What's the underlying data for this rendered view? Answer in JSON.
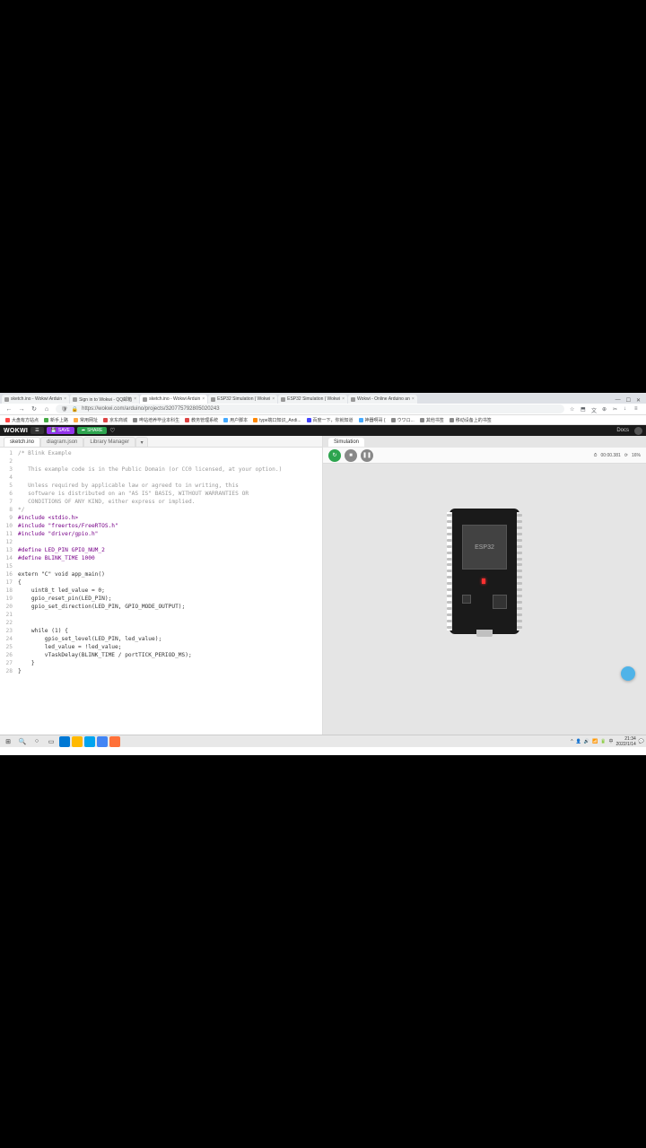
{
  "browser": {
    "tabs": [
      {
        "label": "sketch.ino - Wokwi Arduin",
        "active": false
      },
      {
        "label": "Sign in to Wokwi - QQ邮箱",
        "active": false
      },
      {
        "label": "sketch.ino - Wokwi Arduin",
        "active": true
      },
      {
        "label": "ESP32 Simulation | Wokwi",
        "active": false
      },
      {
        "label": "ESP32 Simulation | Wokwi",
        "active": false
      },
      {
        "label": "Wokwi - Online Arduino an",
        "active": false
      }
    ],
    "url": "https://wokwi.com/arduino/projects/320775792805020243",
    "bookmarks": [
      "大盘有方站点",
      "新手上路",
      "常用网址",
      "京东商城",
      "哔站培养毕业本科生",
      "教务管理系统",
      "用户脚本",
      "type端口知识_Andi...",
      "百度一下，你就知道",
      "神器啊哥 {",
      "ウワロ...",
      "其他书签",
      "移动设备上的书签"
    ]
  },
  "app": {
    "logo": "WOKWI",
    "save": "SAVE",
    "share": "SHARE",
    "docs": "Docs"
  },
  "editor": {
    "tabs": [
      "sketch.ino",
      "diagram.json",
      "Library Manager"
    ],
    "active_tab": 0,
    "code": [
      {
        "n": 1,
        "t": "/* Blink Example",
        "cls": "c-comment"
      },
      {
        "n": 2,
        "t": "",
        "cls": ""
      },
      {
        "n": 3,
        "t": "   This example code is in the Public Domain (or CC0 licensed, at your option.)",
        "cls": "c-comment"
      },
      {
        "n": 4,
        "t": "",
        "cls": ""
      },
      {
        "n": 5,
        "t": "   Unless required by applicable law or agreed to in writing, this",
        "cls": "c-comment"
      },
      {
        "n": 6,
        "t": "   software is distributed on an \"AS IS\" BASIS, WITHOUT WARRANTIES OR",
        "cls": "c-comment"
      },
      {
        "n": 7,
        "t": "   CONDITIONS OF ANY KIND, either express or implied.",
        "cls": "c-comment"
      },
      {
        "n": 8,
        "t": "*/",
        "cls": "c-comment"
      },
      {
        "n": 9,
        "t": "#include <stdio.h>",
        "cls": "c-keyword"
      },
      {
        "n": 10,
        "t": "#include \"freertos/FreeRTOS.h\"",
        "cls": "c-keyword"
      },
      {
        "n": 11,
        "t": "#include \"driver/gpio.h\"",
        "cls": "c-keyword"
      },
      {
        "n": 12,
        "t": "",
        "cls": ""
      },
      {
        "n": 13,
        "t": "#define LED_PIN GPIO_NUM_2",
        "cls": "c-keyword"
      },
      {
        "n": 14,
        "t": "#define BLINK_TIME 1000",
        "cls": "c-keyword"
      },
      {
        "n": 15,
        "t": "",
        "cls": ""
      },
      {
        "n": 16,
        "t": "extern \"C\" void app_main()",
        "cls": ""
      },
      {
        "n": 17,
        "t": "{",
        "cls": ""
      },
      {
        "n": 18,
        "t": "    uint8_t led_value = 0;",
        "cls": ""
      },
      {
        "n": 19,
        "t": "    gpio_reset_pin(LED_PIN);",
        "cls": ""
      },
      {
        "n": 20,
        "t": "    gpio_set_direction(LED_PIN, GPIO_MODE_OUTPUT);",
        "cls": ""
      },
      {
        "n": 21,
        "t": "",
        "cls": ""
      },
      {
        "n": 22,
        "t": "",
        "cls": ""
      },
      {
        "n": 23,
        "t": "    while (1) {",
        "cls": ""
      },
      {
        "n": 24,
        "t": "        gpio_set_level(LED_PIN, led_value);",
        "cls": ""
      },
      {
        "n": 25,
        "t": "        led_value = !led_value;",
        "cls": ""
      },
      {
        "n": 26,
        "t": "        vTaskDelay(BLINK_TIME / portTICK_PERIOD_MS);",
        "cls": ""
      },
      {
        "n": 27,
        "t": "    }",
        "cls": ""
      },
      {
        "n": 28,
        "t": "}",
        "cls": ""
      }
    ]
  },
  "sim": {
    "tab": "Simulation",
    "time_icon": "⏱",
    "time": "00:00.381",
    "perf_icon": "⟳",
    "perf": "16%",
    "chip": "ESP32"
  },
  "taskbar": {
    "time": "21:34",
    "date": "2022/1/14"
  }
}
